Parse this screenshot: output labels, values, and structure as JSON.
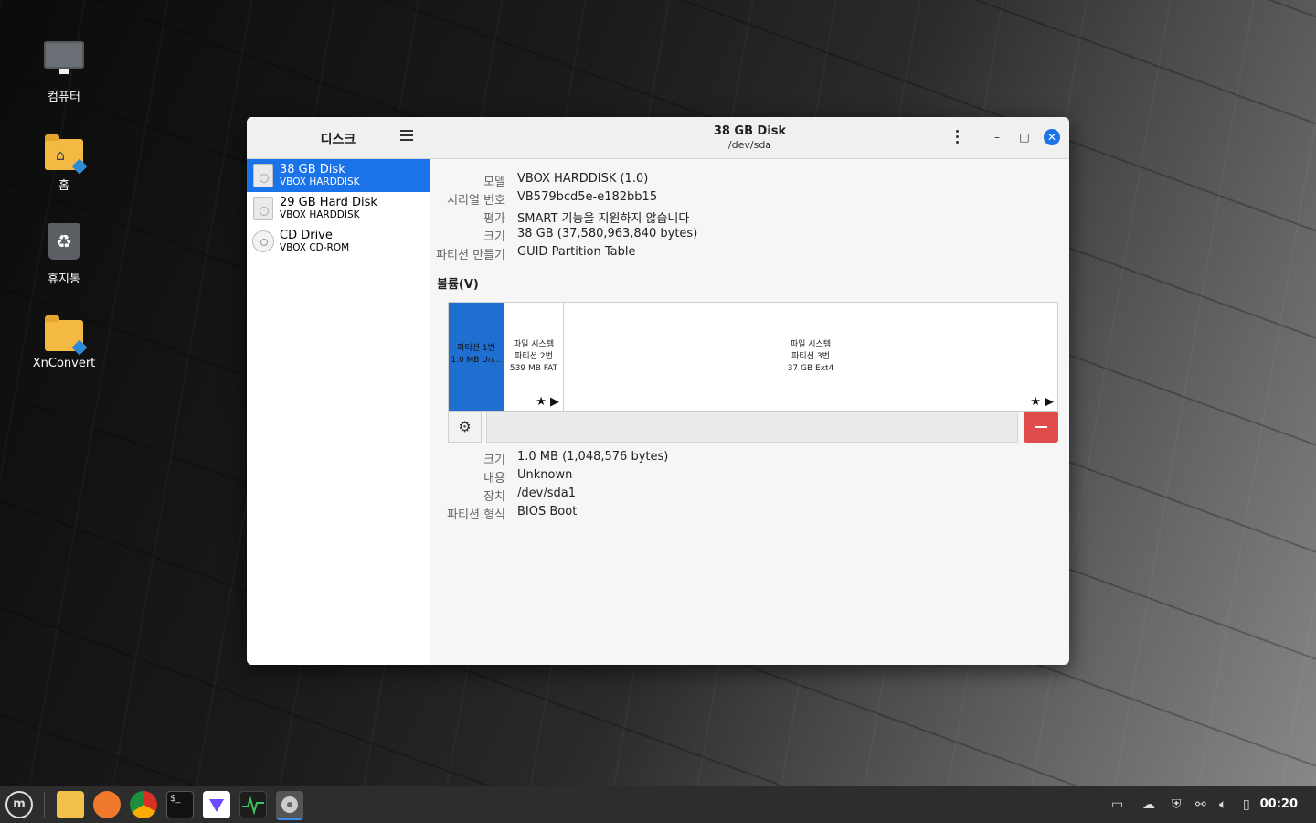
{
  "desktop": {
    "icons": [
      {
        "label": "컴퓨터"
      },
      {
        "label": "홈"
      },
      {
        "label": "휴지통"
      },
      {
        "label": "XnConvert"
      }
    ]
  },
  "window": {
    "sidebar": {
      "title": "디스크",
      "disks": [
        {
          "name": "38 GB Disk",
          "sub": "VBOX HARDDISK"
        },
        {
          "name": "29 GB Hard Disk",
          "sub": "VBOX HARDDISK"
        },
        {
          "name": "CD Drive",
          "sub": "VBOX CD-ROM"
        }
      ]
    },
    "header": {
      "title": "38 GB Disk",
      "subtitle": "/dev/sda"
    },
    "controls": {
      "minimize": "–",
      "maximize": "□",
      "close": "✕"
    },
    "disk_props": [
      {
        "label": "모델",
        "value": "VBOX HARDDISK (1.0)"
      },
      {
        "label": "시리얼 번호",
        "value": "VB579bcd5e-e182bb15"
      },
      {
        "label": "평가",
        "value": "SMART 기능을 지원하지 않습니다"
      },
      {
        "label": "크기",
        "value": "38 GB (37,580,963,840 bytes)"
      },
      {
        "label": "파티션 만들기",
        "value": "GUID Partition Table"
      }
    ],
    "volumes_label": "볼륨(V)",
    "partitions": [
      {
        "line1": "파티션 1번",
        "line2": "1.0 MB Un…",
        "line3": ""
      },
      {
        "line1": "파일 시스템",
        "line2": "파티션 2번",
        "line3": "539 MB FAT"
      },
      {
        "line1": "파일 시스템",
        "line2": "파티션 3번",
        "line3": "37 GB Ext4"
      }
    ],
    "partition_marks": "★ ▶",
    "partition_props": [
      {
        "label": "크기",
        "value": "1.0 MB (1,048,576 bytes)"
      },
      {
        "label": "내용",
        "value": "Unknown"
      },
      {
        "label": "장치",
        "value": "/dev/sda1"
      },
      {
        "label": "파티션 형식",
        "value": "BIOS Boot"
      }
    ]
  },
  "taskbar": {
    "menu_label": "m",
    "apps": [
      "files",
      "firefox",
      "chrome",
      "terminal",
      "protonvpn",
      "system-monitor",
      "disks"
    ],
    "terminal_glyph": "$_",
    "clock": "00:20"
  }
}
